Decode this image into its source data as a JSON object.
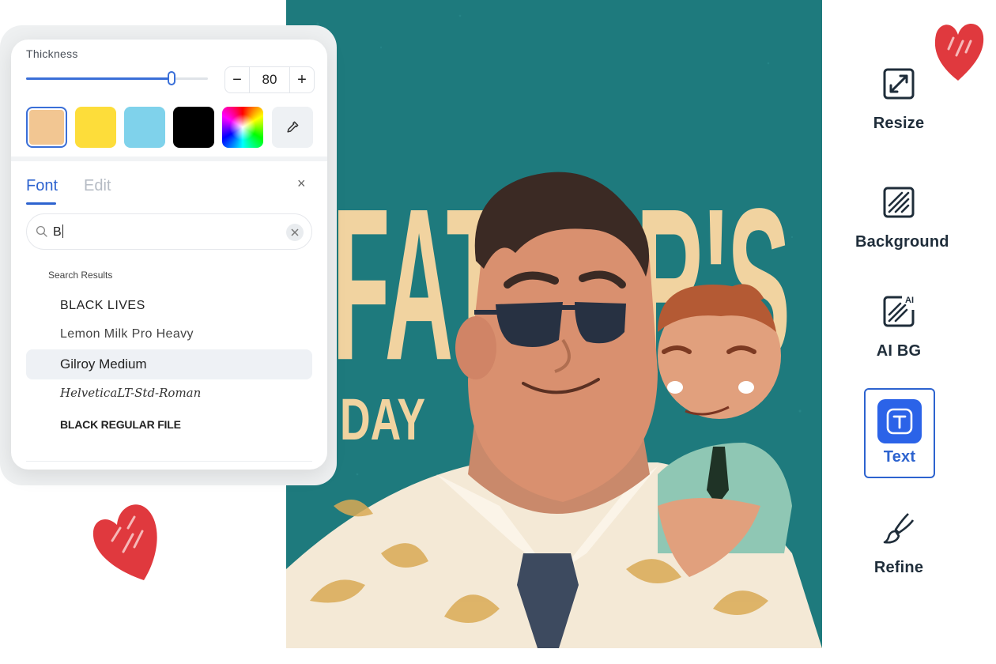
{
  "panel": {
    "thickness_label": "Thickness",
    "thickness_value": "80",
    "thickness_fraction": 0.8,
    "minus_label": "−",
    "plus_label": "+",
    "swatches": [
      {
        "color": "#f2c692",
        "selected": true
      },
      {
        "color": "#fddd3a",
        "selected": false
      },
      {
        "color": "#7fd2eb",
        "selected": false
      },
      {
        "color": "#000000",
        "selected": false
      },
      {
        "color": "rainbow",
        "selected": false
      }
    ],
    "tabs": [
      {
        "label": "Font",
        "active": true
      },
      {
        "label": "Edit",
        "active": false
      }
    ],
    "close_label": "×",
    "search": {
      "value": "B"
    },
    "results_label": "Search Results",
    "results": [
      {
        "label": "BLACK LIVES",
        "highlighted": false
      },
      {
        "label": "Lemon Milk Pro Heavy",
        "highlighted": false
      },
      {
        "label": "Gilroy Medium",
        "highlighted": true
      },
      {
        "label": "HelveticaLT-Std-Roman",
        "highlighted": false
      },
      {
        "label": "BLACK REGULAR FILE",
        "highlighted": false
      }
    ]
  },
  "poster": {
    "title_line1": "FATHER'S",
    "title_line2": "DAY",
    "bg_color": "#1e7a7d",
    "letter_color": "#f1d3a0"
  },
  "tools": [
    {
      "label": "Resize",
      "icon": "resize-icon",
      "active": false
    },
    {
      "label": "Background",
      "icon": "background-icon",
      "active": false
    },
    {
      "label": "AI BG",
      "icon": "ai-bg-icon",
      "active": false,
      "badge": "AI"
    },
    {
      "label": "Text",
      "icon": "text-icon",
      "active": true
    },
    {
      "label": "Refine",
      "icon": "brush-icon",
      "active": false
    }
  ],
  "colors": {
    "accent": "#2d63cf",
    "heart": "#e0393e"
  }
}
